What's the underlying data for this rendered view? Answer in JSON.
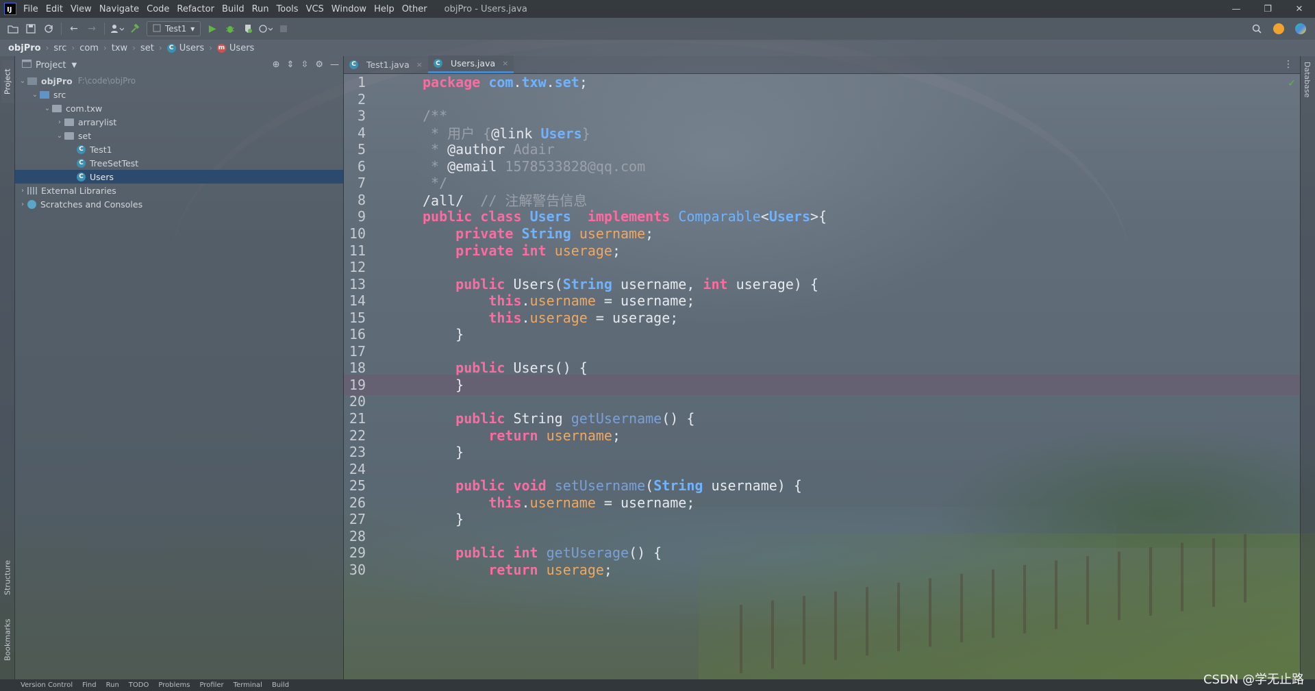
{
  "window": {
    "title": "objPro - Users.java",
    "controls": [
      "—",
      "❐",
      "✕"
    ]
  },
  "menu": [
    "File",
    "Edit",
    "View",
    "Navigate",
    "Code",
    "Refactor",
    "Build",
    "Run",
    "Tools",
    "VCS",
    "Window",
    "Help",
    "Other"
  ],
  "toolbar": {
    "run_config": "Test1"
  },
  "breadcrumb": [
    "objPro",
    "src",
    "com",
    "txw",
    "set",
    "Users",
    "Users"
  ],
  "left_tools": {
    "project": "Project",
    "structure": "Structure",
    "bookmarks": "Bookmarks"
  },
  "right_tools": {
    "database": "Database"
  },
  "project_panel": {
    "title": "Project",
    "tree": [
      {
        "label": "objPro",
        "hint": "F:\\code\\objPro",
        "kind": "module",
        "depth": 0,
        "expanded": true
      },
      {
        "label": "src",
        "kind": "folder-blue",
        "depth": 1,
        "expanded": true
      },
      {
        "label": "com.txw",
        "kind": "folder",
        "depth": 2,
        "expanded": true
      },
      {
        "label": "arrarylist",
        "kind": "folder",
        "depth": 3,
        "expanded": false
      },
      {
        "label": "set",
        "kind": "folder",
        "depth": 3,
        "expanded": true
      },
      {
        "label": "Test1",
        "kind": "java",
        "depth": 4
      },
      {
        "label": "TreeSetTest",
        "kind": "java",
        "depth": 4
      },
      {
        "label": "Users",
        "kind": "java",
        "depth": 4,
        "selected": true
      },
      {
        "label": "External Libraries",
        "kind": "lib",
        "depth": 0,
        "expanded": false
      },
      {
        "label": "Scratches and Consoles",
        "kind": "scratch",
        "depth": 0,
        "expanded": false
      }
    ]
  },
  "editor_tabs": [
    {
      "label": "Test1.java",
      "active": false
    },
    {
      "label": "Users.java",
      "active": true
    }
  ],
  "code_lines": [
    "package com.txw.set;",
    "",
    "/**",
    " * 用户 {@link Users}",
    " * @author Adair",
    " * @email 1578533828@qq.com",
    " */",
    "/all/  // 注解警告信息",
    "public class Users  implements Comparable<Users>{",
    "    private String username;",
    "    private int userage;",
    "",
    "    public Users(String username, int userage) {",
    "        this.username = username;",
    "        this.userage = userage;",
    "    }",
    "",
    "    public Users() {",
    "    }",
    "",
    "    public String getUsername() {",
    "        return username;",
    "    }",
    "",
    "    public void setUsername(String username) {",
    "        this.username = username;",
    "    }",
    "",
    "    public int getUserage() {",
    "        return userage;"
  ],
  "highlighted_line": 19,
  "statusbar": [
    "Version Control",
    "Find",
    "Run",
    "TODO",
    "Problems",
    "Profiler",
    "Terminal",
    "Build"
  ],
  "watermark": "CSDN @学无止路",
  "colors": {
    "keyword": "#ff6aa0",
    "type": "#6fb3ff",
    "field": "#f0a860",
    "selection": "#23466e"
  }
}
